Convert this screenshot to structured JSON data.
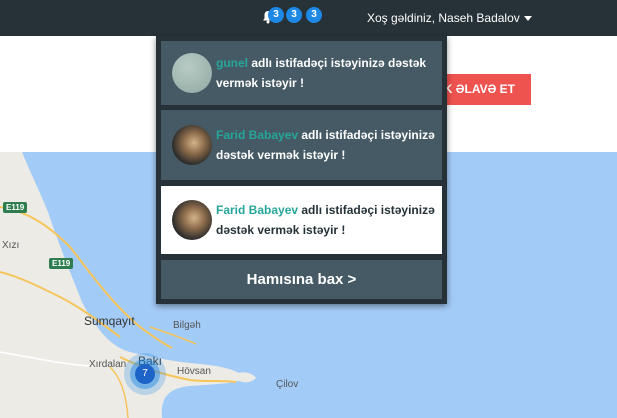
{
  "header": {
    "welcome_text": "Xoş gəldiniz, Naseh Badalov",
    "badges": [
      "3",
      "3",
      "3"
    ]
  },
  "add_button_label": "ƏK ƏLAVƏ ET",
  "notifications": {
    "items": [
      {
        "user": "gunel",
        "message": " adlı istifadəçi istəyinizə dəstək vermək istəyir !",
        "theme": "dark"
      },
      {
        "user": "Farid Babayev",
        "message": " adlı istifadəçi istəyinizə dəstək vermək istəyir !",
        "theme": "dark"
      },
      {
        "user": "Farid Babayev",
        "message": " adlı istifadəçi istəyinizə dəstək vermək istəyir !",
        "theme": "light"
      }
    ],
    "see_all_label": "Hamısına bax >"
  },
  "map": {
    "labels": {
      "xizi": "Xızı",
      "sumqayit": "Sumqayıt",
      "bilgeh": "Bilgəh",
      "xirdalan": "Xırdalan",
      "baki": "Bakı",
      "hovsan": "Hövsan",
      "cilov": "Çilov"
    },
    "shields": [
      "E119",
      "E119"
    ],
    "cluster_count": "7"
  },
  "colors": {
    "topbar": "#263238",
    "accent_red": "#ef5350",
    "username": "#26a69a",
    "badge": "#1e88e5",
    "water": "#a3cbf7"
  }
}
